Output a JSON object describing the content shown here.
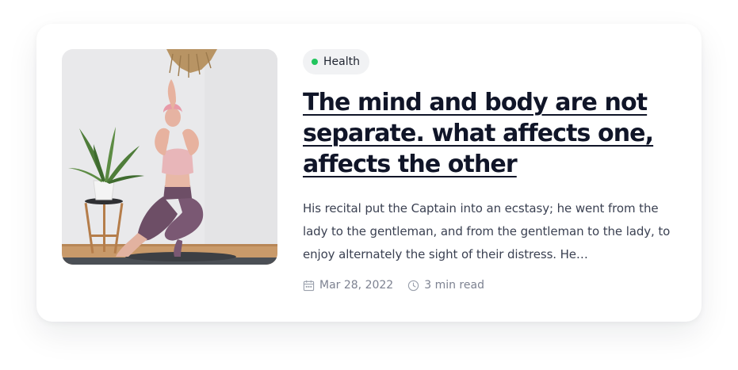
{
  "post": {
    "image_alt": "Woman doing a yoga pose beside a plant",
    "category": {
      "label": "Health",
      "dot_color": "#22c55e"
    },
    "title": "The mind and body are not separate. what affects one, affects the other",
    "excerpt": "His recital put the Captain into an ecstasy; he went from the lady to the gentleman, and from the gentleman to the lady, to enjoy alternately the sight of their distress. He…",
    "meta": {
      "date": "Mar 28, 2022",
      "date_icon": "calendar-icon",
      "read_time": "3 min read",
      "read_time_icon": "clock-icon"
    }
  },
  "colors": {
    "title": "#101528",
    "body_text": "#3b4152",
    "meta_text": "#7d8291",
    "tag_background": "#f1f2f4"
  }
}
